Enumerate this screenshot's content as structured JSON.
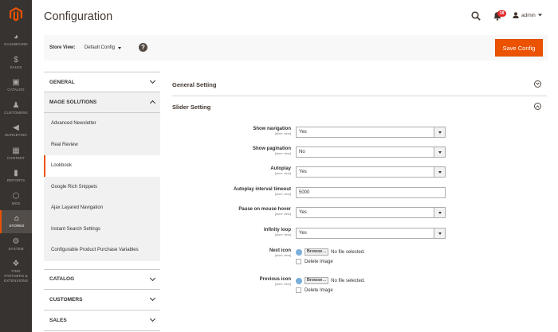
{
  "nav": {
    "items": [
      {
        "icon": "dashboard-icon",
        "glyph": "◕",
        "label": "DASHBOARD"
      },
      {
        "icon": "dollar-icon",
        "glyph": "$",
        "label": "SALES"
      },
      {
        "icon": "box-icon",
        "glyph": "▣",
        "label": "CATALOG"
      },
      {
        "icon": "person-icon",
        "glyph": "♟",
        "label": "CUSTOMERS"
      },
      {
        "icon": "megaphone-icon",
        "glyph": "◀",
        "label": "MARKETING"
      },
      {
        "icon": "content-icon",
        "glyph": "▦",
        "label": "CONTENT"
      },
      {
        "icon": "bar-chart-icon",
        "glyph": "▮",
        "label": "REPORTS"
      },
      {
        "icon": "hexagon-icon",
        "glyph": "⬡",
        "label": "MGS"
      },
      {
        "icon": "store-icon",
        "glyph": "⌂",
        "label": "STORES"
      },
      {
        "icon": "gear-icon",
        "glyph": "⚙",
        "label": "SYSTEM"
      },
      {
        "icon": "puzzle-icon",
        "glyph": "❖",
        "label": "FIND PARTNERS & EXTENSIONS"
      }
    ]
  },
  "header": {
    "title": "Configuration",
    "notifications": "18",
    "user": "admin"
  },
  "store_bar": {
    "label": "Store View:",
    "value": "Default Config",
    "help": "?",
    "save_label": "Save Config"
  },
  "sidebar": {
    "general": "GENERAL",
    "mage_solutions": "MAGE SOLUTIONS",
    "sub_items": [
      "Advanced Newsletter",
      "Real Review",
      "Lookbook",
      "Google Rich Snippets",
      "Ajax Layared Navigation",
      "Instant Search Settings",
      "Configurable Product Purchase Variables"
    ],
    "catalog": "CATALOG",
    "customers": "CUSTOMERS",
    "sales": "SALES"
  },
  "main": {
    "general_setting": "General Setting",
    "slider_setting": "Slider Setting",
    "scope": "[store view]",
    "fields": [
      {
        "label": "Show navigation",
        "value": "Yes"
      },
      {
        "label": "Show pagination",
        "value": "No"
      },
      {
        "label": "Autoplay",
        "value": "Yes"
      },
      {
        "label": "Autoplay interval timeout",
        "value": "5000"
      },
      {
        "label": "Pause on mouse hover",
        "value": "Yes"
      },
      {
        "label": "Infinity loop",
        "value": "Yes"
      }
    ],
    "next_icon": {
      "label": "Next icon",
      "browse": "Browse...",
      "no_file": "No file selected.",
      "delete": "Delete Image"
    },
    "previous_icon": {
      "label": "Previous icon",
      "browse": "Browse...",
      "no_file": "No file selected.",
      "delete": "Delete Image"
    }
  }
}
